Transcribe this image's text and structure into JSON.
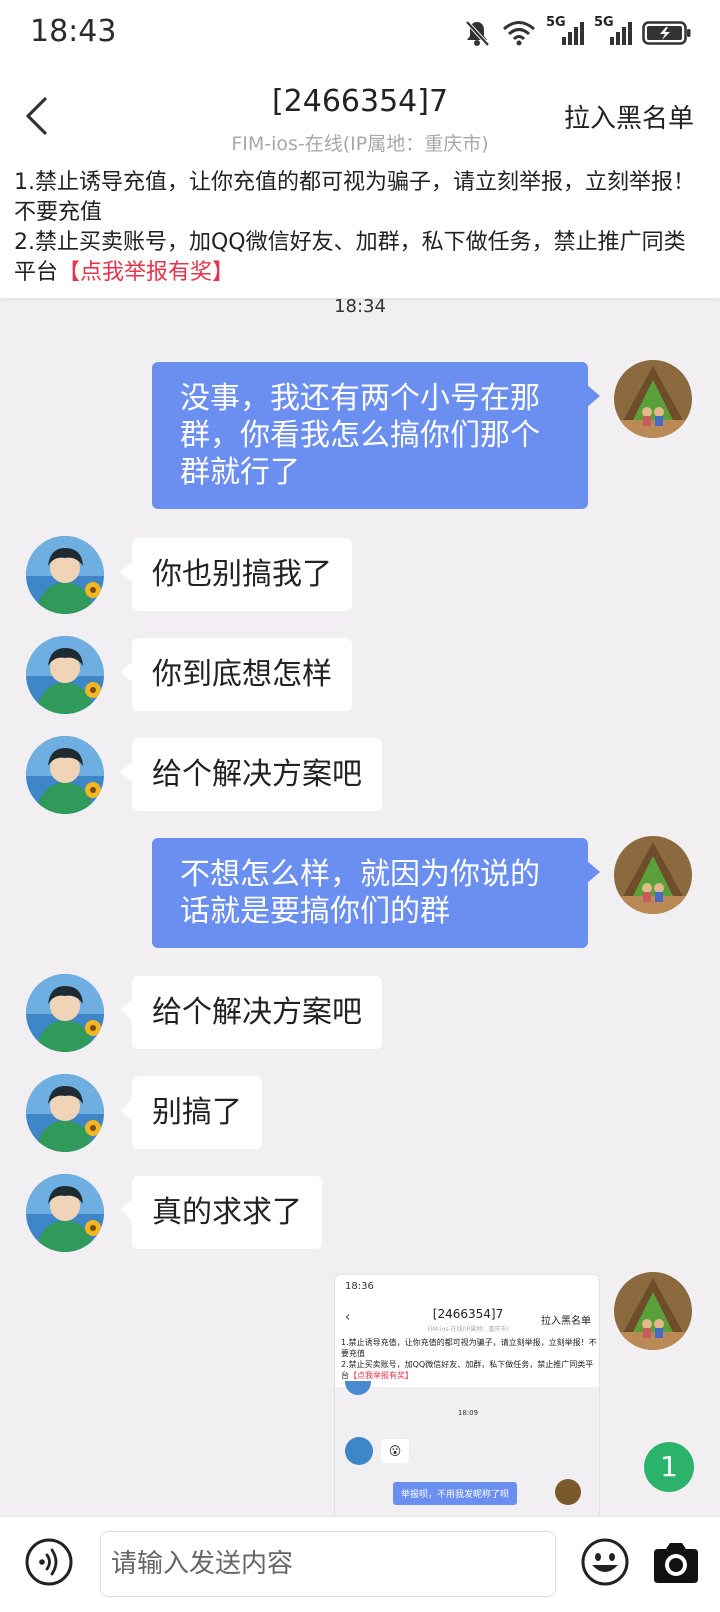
{
  "status_bar": {
    "time": "18:43",
    "signal1_label": "5G",
    "signal2_label": "5G"
  },
  "header": {
    "title": "[2466354]7",
    "subtitle": "FIM-ios-在线(IP属地：重庆市)",
    "blacklist_label": "拉入黑名单"
  },
  "notice": {
    "line1": "1.禁止诱导充值，让你充值的都可视为骗子，请立刻举报，立刻举报！不要充值",
    "line2": "2.禁止买卖账号，加QQ微信好友、加群，私下做任务，禁止推广同类平台",
    "report_link": "【点我举报有奖】"
  },
  "chat": {
    "time_label": "18:34",
    "messages": [
      {
        "sender": "me",
        "text": "没事，我还有两个小号在那群，你看我怎么搞你们那个群就行了"
      },
      {
        "sender": "other",
        "text": "你也别搞我了"
      },
      {
        "sender": "other",
        "text": "你到底想怎样"
      },
      {
        "sender": "other",
        "text": "给个解决方案吧"
      },
      {
        "sender": "me",
        "text": "不想怎么样，就因为你说的话就是要搞你们的群"
      },
      {
        "sender": "other",
        "text": "给个解决方案吧"
      },
      {
        "sender": "other",
        "text": "别搞了"
      },
      {
        "sender": "other",
        "text": "真的求求了"
      }
    ],
    "image_message": {
      "status_time": "18:36",
      "title": "[2466354]7",
      "subtitle": "FIM-ios-在线(IP属地：重庆市)",
      "blacklist_label": "拉入黑名单",
      "notice_line1": "1.禁止诱导充值，让你充值的都可视为骗子，请立刻举报，立刻举报！不要充值",
      "notice_line2": "2.禁止买卖账号，加QQ微信好友、加群，私下做任务，禁止推广同类平台",
      "report_link": "【点我举报有奖】",
      "time_label": "18:09",
      "bubble_text": "举报呗，不用我发昵称了呗"
    },
    "unread_count": "1"
  },
  "input_bar": {
    "placeholder": "请输入发送内容"
  },
  "colors": {
    "my_bubble": "#6b8ff1",
    "report_link": "#e8334a",
    "badge": "#2bb36b"
  }
}
